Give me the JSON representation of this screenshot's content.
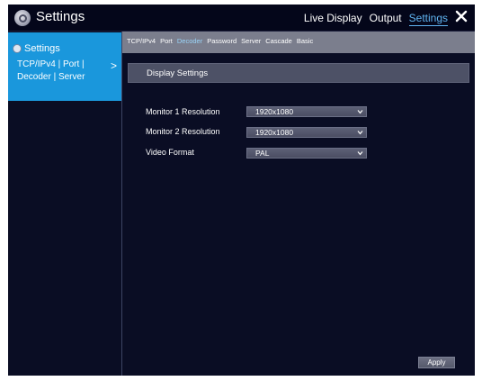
{
  "header": {
    "title": "Settings",
    "nav": [
      "Live Display",
      "Output",
      "Settings"
    ],
    "active_nav": "Settings",
    "close_icon": "close-icon"
  },
  "sidebar": {
    "heading": "Settings",
    "sub_items": "TCP/IPv4 | Port | Decoder | Server",
    "chevron": ">"
  },
  "tabs": {
    "items": [
      "TCP/IPv4",
      "Port",
      "Decoder",
      "Password",
      "Server",
      "Cascade",
      "Basic"
    ],
    "active": "Decoder"
  },
  "section": {
    "title": "Display Settings"
  },
  "fields": [
    {
      "label": "Monitor 1 Resolution",
      "value": "1920x1080"
    },
    {
      "label": "Monitor 2 Resolution",
      "value": "1920x1080"
    },
    {
      "label": "Video Format",
      "value": "PAL"
    }
  ],
  "apply_label": "Apply",
  "colors": {
    "accent": "#1a97dc",
    "active_tab": "#9ad4f8",
    "background": "#0a0d24"
  }
}
